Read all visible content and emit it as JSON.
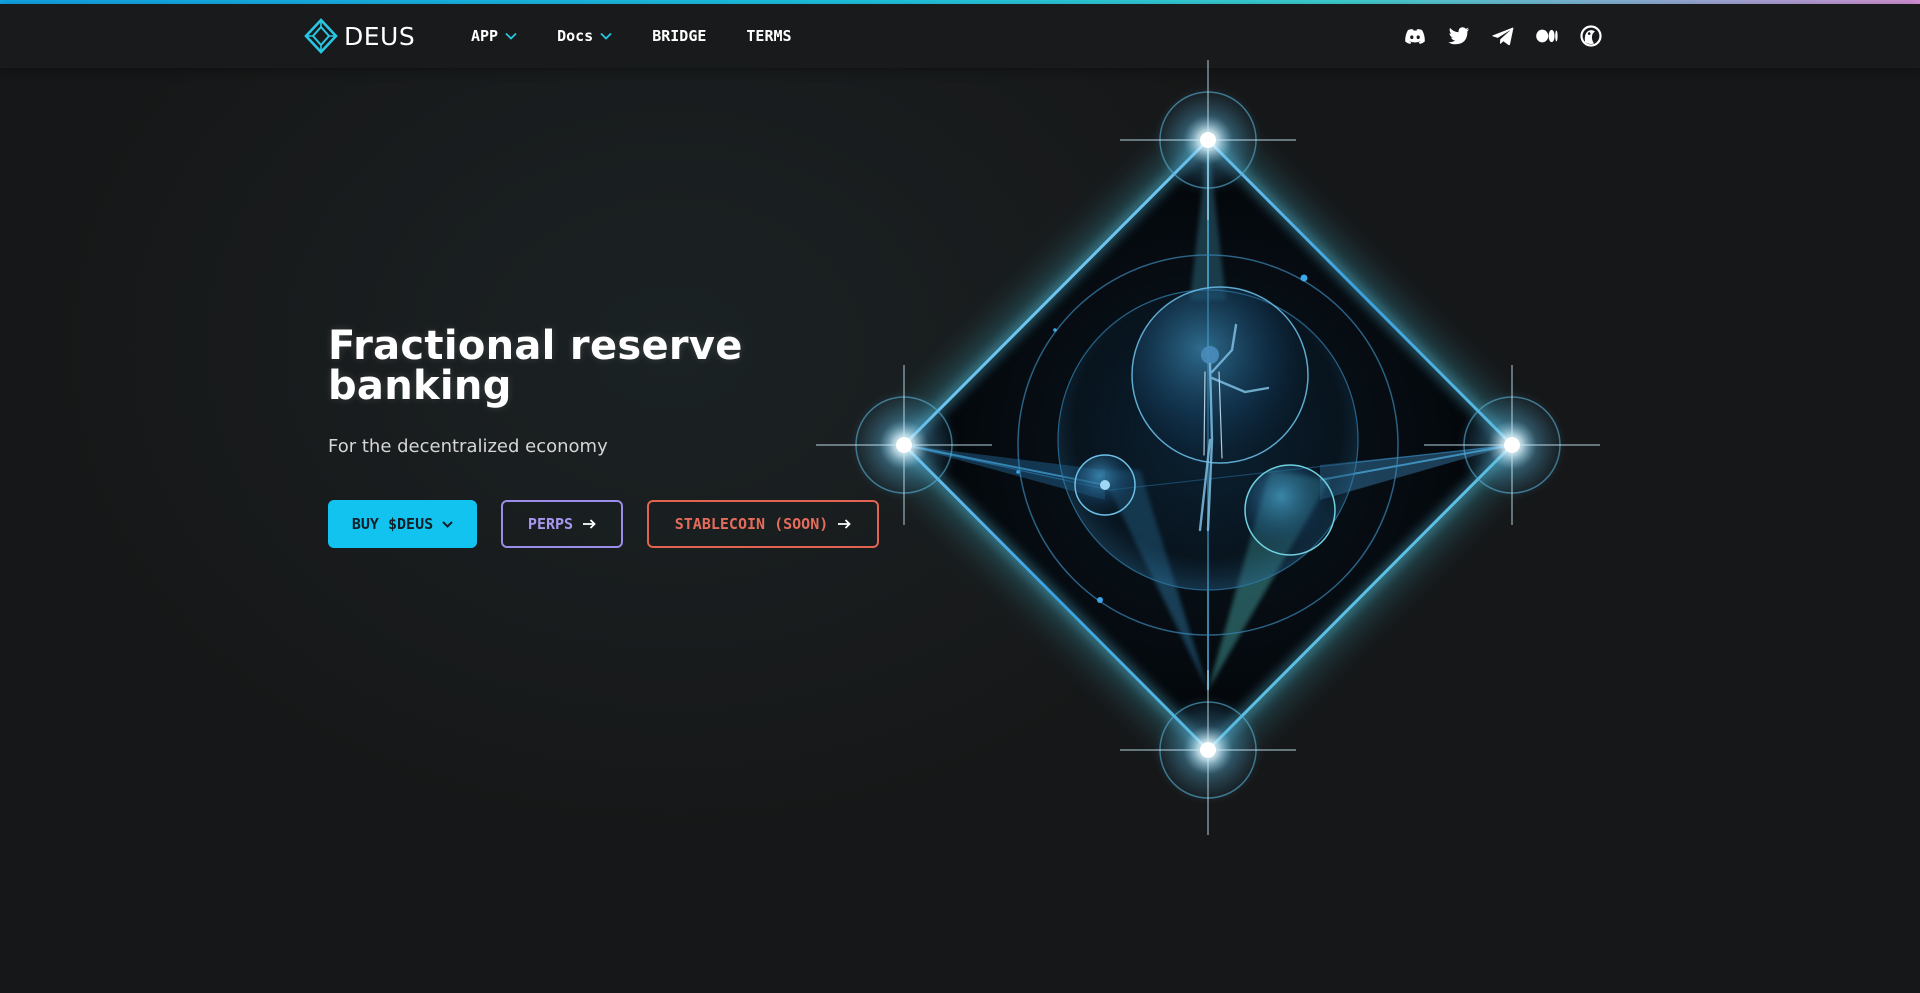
{
  "brand": {
    "name": "DEUS"
  },
  "nav": {
    "items": [
      {
        "label": "APP",
        "has_dropdown": true
      },
      {
        "label": "Docs",
        "has_dropdown": true
      },
      {
        "label": "BRIDGE",
        "has_dropdown": false
      },
      {
        "label": "TERMS",
        "has_dropdown": false
      }
    ],
    "socials": [
      "discord-icon",
      "twitter-icon",
      "telegram-icon",
      "medium-icon",
      "coingecko-icon"
    ]
  },
  "hero": {
    "title_line1": "Fractional reserve",
    "title_line2": "banking",
    "subtitle": "For the decentralized economy",
    "buttons": {
      "buy": "BUY $DEUS",
      "perps": "PERPS",
      "stablecoin": "STABLECOIN (SOON)"
    }
  },
  "colors": {
    "background": "#161718",
    "navbar": "#191a1b",
    "accent_cyan": "#12c3ef",
    "perps_purple": "#9a8ce8",
    "stablecoin_orange": "#e0644f",
    "chevron_cyan": "#27c8e6"
  }
}
